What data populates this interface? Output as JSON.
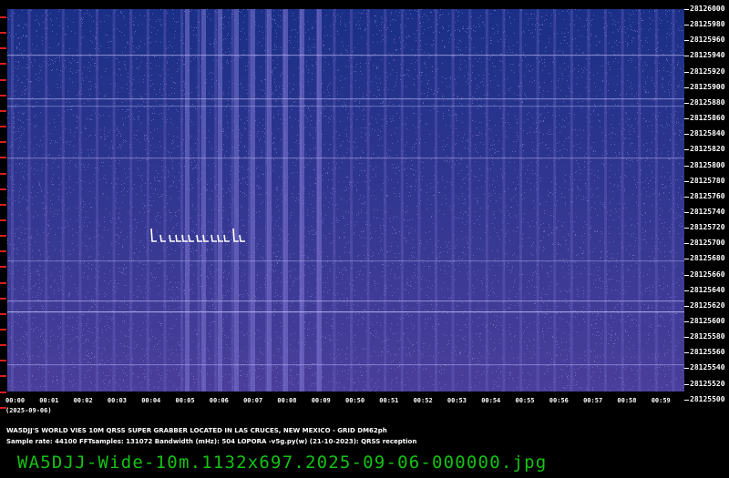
{
  "window_title": "",
  "spectrogram": {
    "background_top": "#1a2f86",
    "background_bottom": "#4a3f9b",
    "trace_color": "#ffffff",
    "noise_color": "#8b86d8"
  },
  "frequency_axis": [
    "28126000",
    "28125980",
    "28125960",
    "28125940",
    "28125920",
    "28125900",
    "28125880",
    "28125860",
    "28125840",
    "28125820",
    "28125800",
    "28125780",
    "28125760",
    "28125740",
    "28125720",
    "28125700",
    "28125680",
    "28125660",
    "28125640",
    "28125620",
    "28125600",
    "28125580",
    "28125560",
    "28125540",
    "28125520",
    "28125500"
  ],
  "time_axis": [
    "00:00",
    "00:01",
    "00:02",
    "00:03",
    "00:04",
    "00:05",
    "00:06",
    "00:07",
    "00:08",
    "00:09",
    "00:50",
    "00:51",
    "00:52",
    "00:53",
    "00:54",
    "00:55",
    "00:56",
    "00:57",
    "00:58",
    "00:59"
  ],
  "date": "(2025-09-06)",
  "info": {
    "line1": "WA5DJJ'S WORLD VIES 10M QRSS SUPER GRABBER LOCATED IN LAS CRUCES, NEW MEXICO - GRID DM62ph",
    "line2": "Sample rate: 44100     FFTsamples: 131072     Bandwidth (mHz): 504          LOPORA -v5g.py(w) (21-10-2023): QRSS reception"
  },
  "footer": {
    "filename": "WA5DJJ-Wide-10m.1132x697.2025-09-06-000000.jpg",
    "color": "#13c313"
  }
}
